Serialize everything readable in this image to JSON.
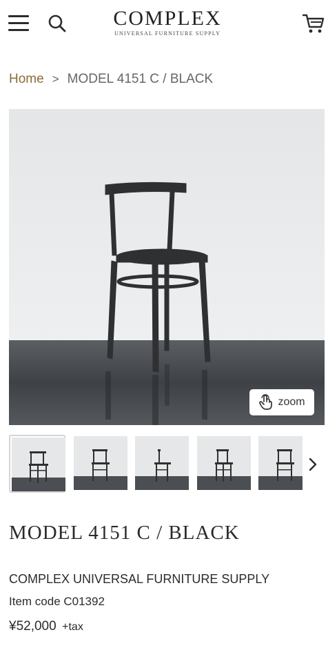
{
  "header": {
    "menu_icon": "hamburger-menu-icon",
    "search_icon": "search-icon",
    "logo_main": "COMPLEX",
    "logo_sub": "UNIVERSAL FURNITURE SUPPLY",
    "cart_icon": "cart-icon"
  },
  "breadcrumb": {
    "home": "Home",
    "separator": ">",
    "current": "MODEL 4151 C / BLACK"
  },
  "gallery": {
    "zoom_label": "zoom",
    "zoom_icon": "touch-hand-icon",
    "thumbnail_count_visible": 5,
    "active_thumbnail": 1,
    "next_icon": "chevron-right-icon"
  },
  "product": {
    "title": "MODEL 4151 C / BLACK",
    "brand": "COMPLEX UNIVERSAL FURNITURE SUPPLY",
    "item_code": "Item code C01392",
    "price": "¥52,000",
    "tax": "+tax"
  },
  "colors": {
    "accent_link": "#8a6d3b",
    "text": "#2b2b2b"
  }
}
